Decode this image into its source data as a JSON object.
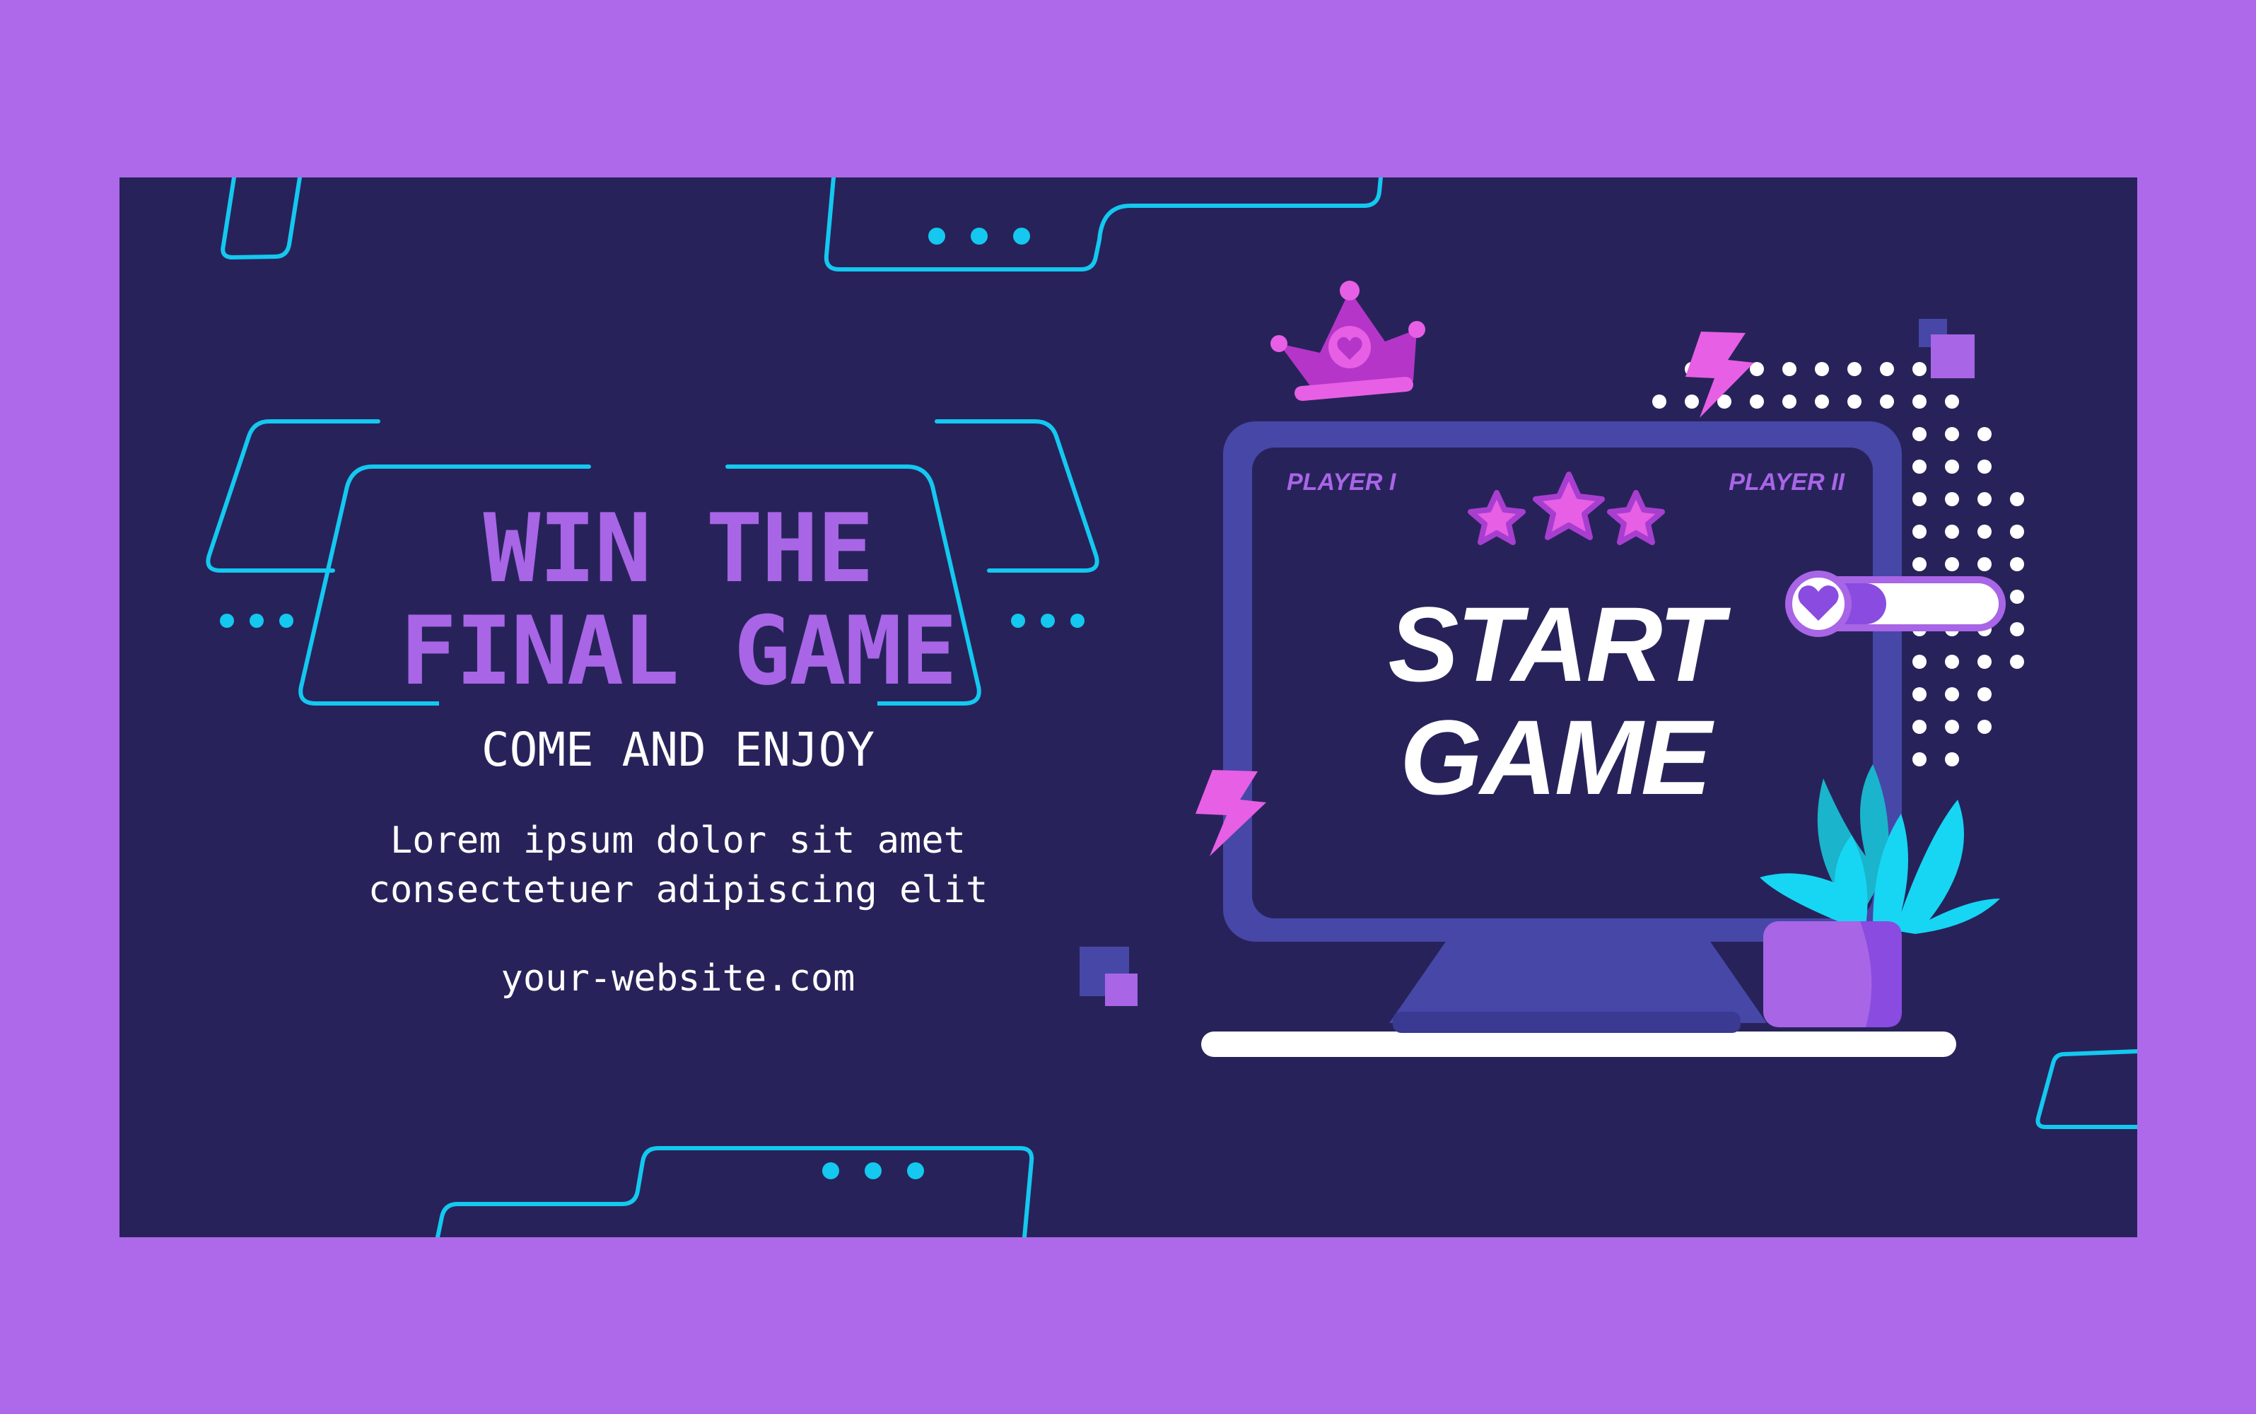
{
  "headline": {
    "line1": "WIN THE",
    "line2": "FINAL GAME"
  },
  "tagline": "COME AND ENJOY",
  "body": {
    "line1": "Lorem ipsum dolor sit amet",
    "line2": "consectetuer adipiscing elit"
  },
  "website": "your-website.com",
  "monitor": {
    "player1": "PLAYER I",
    "player2": "PLAYER II",
    "title_line1": "START",
    "title_line2": "GAME"
  },
  "health_bar": {
    "level": 0.45
  },
  "colors": {
    "page_background": "#ad69ea",
    "banner_background": "#27235a",
    "headline": "#a865e6",
    "neon_outline": "#14c8f0",
    "monitor_frame": "#4747a8",
    "accent_pink": "#e75fe5",
    "text": "#ffffff"
  },
  "icons": [
    "crown-heart-icon",
    "lightning-icon",
    "star-icon",
    "heart-icon",
    "plant-icon"
  ]
}
